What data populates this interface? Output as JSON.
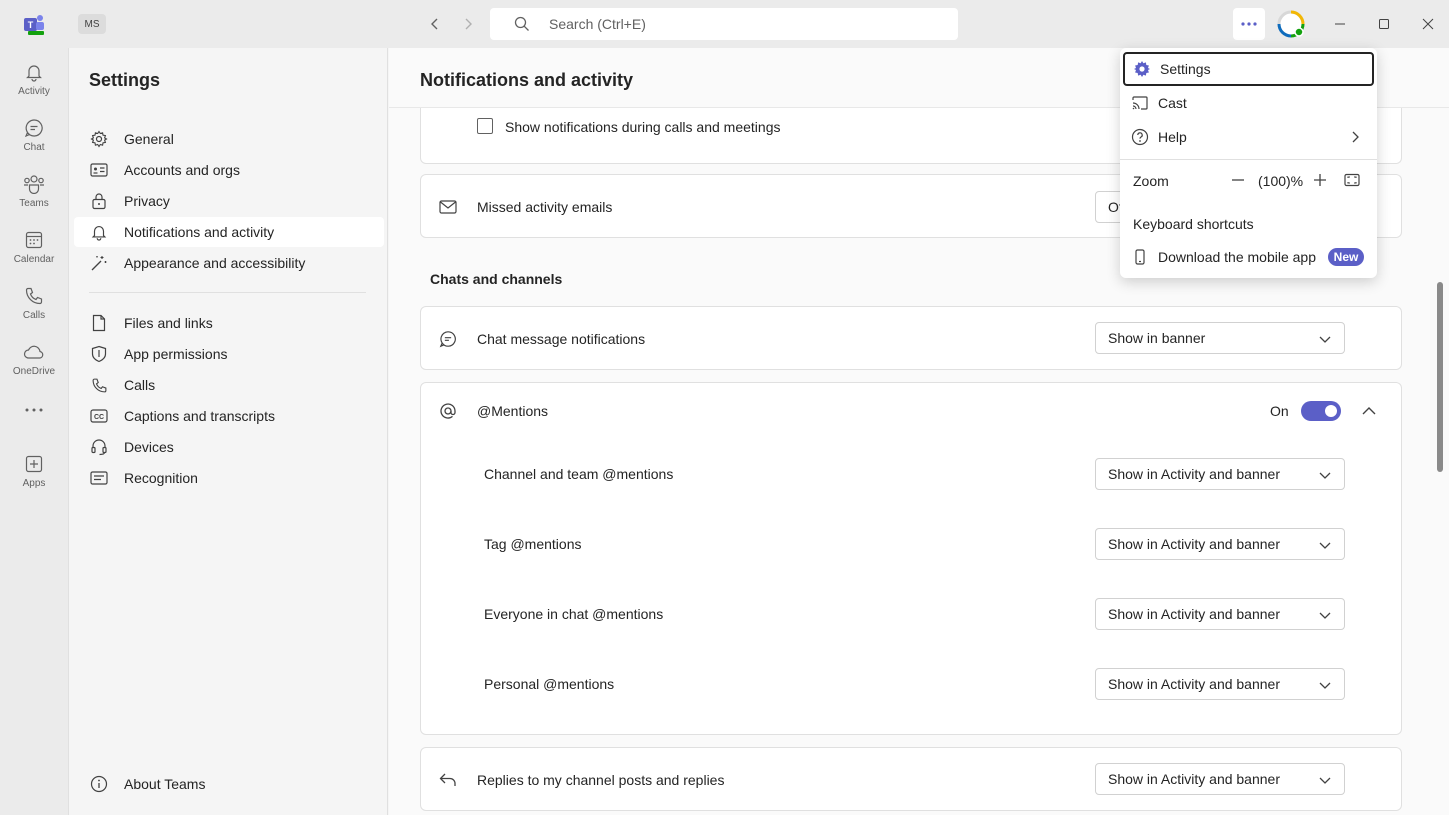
{
  "titlebar": {
    "ms_initials": "MS",
    "search_placeholder": "Search (Ctrl+E)"
  },
  "rail": [
    {
      "label": "Activity",
      "icon": "bell-icon"
    },
    {
      "label": "Chat",
      "icon": "chat-icon"
    },
    {
      "label": "Teams",
      "icon": "teams-icon"
    },
    {
      "label": "Calendar",
      "icon": "calendar-icon"
    },
    {
      "label": "Calls",
      "icon": "phone-icon"
    },
    {
      "label": "OneDrive",
      "icon": "cloud-icon"
    },
    {
      "label": "Apps",
      "icon": "plus-square-icon"
    }
  ],
  "settings": {
    "title": "Settings",
    "items": [
      {
        "label": "General"
      },
      {
        "label": "Accounts and orgs"
      },
      {
        "label": "Privacy"
      },
      {
        "label": "Notifications and activity"
      },
      {
        "label": "Appearance and accessibility"
      },
      {
        "label": "Files and links"
      },
      {
        "label": "App permissions"
      },
      {
        "label": "Calls"
      },
      {
        "label": "Captions and transcripts"
      },
      {
        "label": "Devices"
      },
      {
        "label": "Recognition"
      }
    ],
    "about": "About Teams"
  },
  "main": {
    "title": "Notifications and activity",
    "show_during_calls": "Show notifications during calls and meetings",
    "missed_emails": {
      "label": "Missed activity emails",
      "value": "Of"
    },
    "section_chats": "Chats and channels",
    "chat_notifications": {
      "label": "Chat message notifications",
      "value": "Show in banner"
    },
    "mentions": {
      "label": "@Mentions",
      "toggle_label": "On",
      "toggle_on": true,
      "rows": [
        {
          "label": "Channel and team @mentions",
          "value": "Show in Activity and banner"
        },
        {
          "label": "Tag @mentions",
          "value": "Show in Activity and banner"
        },
        {
          "label": "Everyone in chat @mentions",
          "value": "Show in Activity and banner"
        },
        {
          "label": "Personal @mentions",
          "value": "Show in Activity and banner"
        }
      ]
    },
    "replies": {
      "label": "Replies to my channel posts and replies",
      "value": "Show in Activity and banner"
    }
  },
  "menu": {
    "settings": "Settings",
    "cast": "Cast",
    "help": "Help",
    "zoom_label": "Zoom",
    "zoom_value": "(100)%",
    "keyboard_shortcuts": "Keyboard shortcuts",
    "download_mobile": "Download the mobile app",
    "new_badge": "New"
  },
  "colors": {
    "accent": "#5b5fc7"
  }
}
